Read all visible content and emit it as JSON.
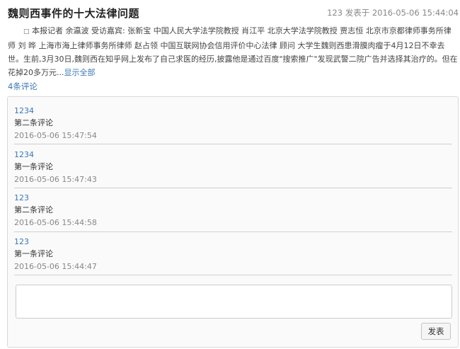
{
  "article": {
    "title": "魏则西事件的十大法律问题",
    "views": "123",
    "posted_label": "发表于",
    "posted_time": "2016-05-06 15:44:04",
    "summary_bullet": "□",
    "summary": "本报记者 余瀛波      受访嘉宾:      张新宝 中国人民大学法学院教授      肖江平 北京大学法学院教授      贾志恒 北京市京都律师事务所律师      刘 晔 上海市海上律师事务所律师      赵占领 中国互联网协会信用评价中心法律 顾问      大学生魏则西患滑膜肉瘤于4月12日不幸去世。生前,3月30日,魏则西在知乎网上发布了自己求医的经历,披露他是通过百度\"搜索推广\"发现武警二院广告并选择其治疗的。但在花掉20多万元...",
    "show_all": "显示全部"
  },
  "comments_count": "4条评论",
  "comments": [
    {
      "user": "1234",
      "text": "第二条评论",
      "time": "2016-05-06 15:47:54"
    },
    {
      "user": "1234",
      "text": "第一条评论",
      "time": "2016-05-06 15:47:43"
    },
    {
      "user": "123",
      "text": "第二条评论",
      "time": "2016-05-06 15:44:58"
    },
    {
      "user": "123",
      "text": "第一条评论",
      "time": "2016-05-06 15:44:47"
    }
  ],
  "comment_input": {
    "placeholder": "",
    "value": ""
  },
  "post_button": "发表"
}
